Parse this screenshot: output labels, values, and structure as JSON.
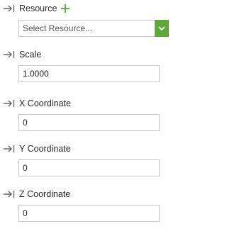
{
  "resource": {
    "label": "Resource",
    "placeholder_text": "Select Resource..."
  },
  "scale": {
    "label": "Scale",
    "value": "1.0000"
  },
  "x_coordinate": {
    "label": "X Coordinate",
    "value": "0"
  },
  "y_coordinate": {
    "label": "Y Coordinate",
    "value": "0"
  },
  "z_coordinate": {
    "label": "Z Coordinate",
    "value": "0"
  },
  "icons": {
    "row_marker": "arrow-into-bar-icon",
    "add": "plus-icon",
    "dropdown": "chevron-down-icon"
  },
  "colors": {
    "accent_green": "#5fa83a",
    "plus_green": "#4caf2e",
    "border": "#c8c8c8",
    "icon_gray": "#666666"
  }
}
